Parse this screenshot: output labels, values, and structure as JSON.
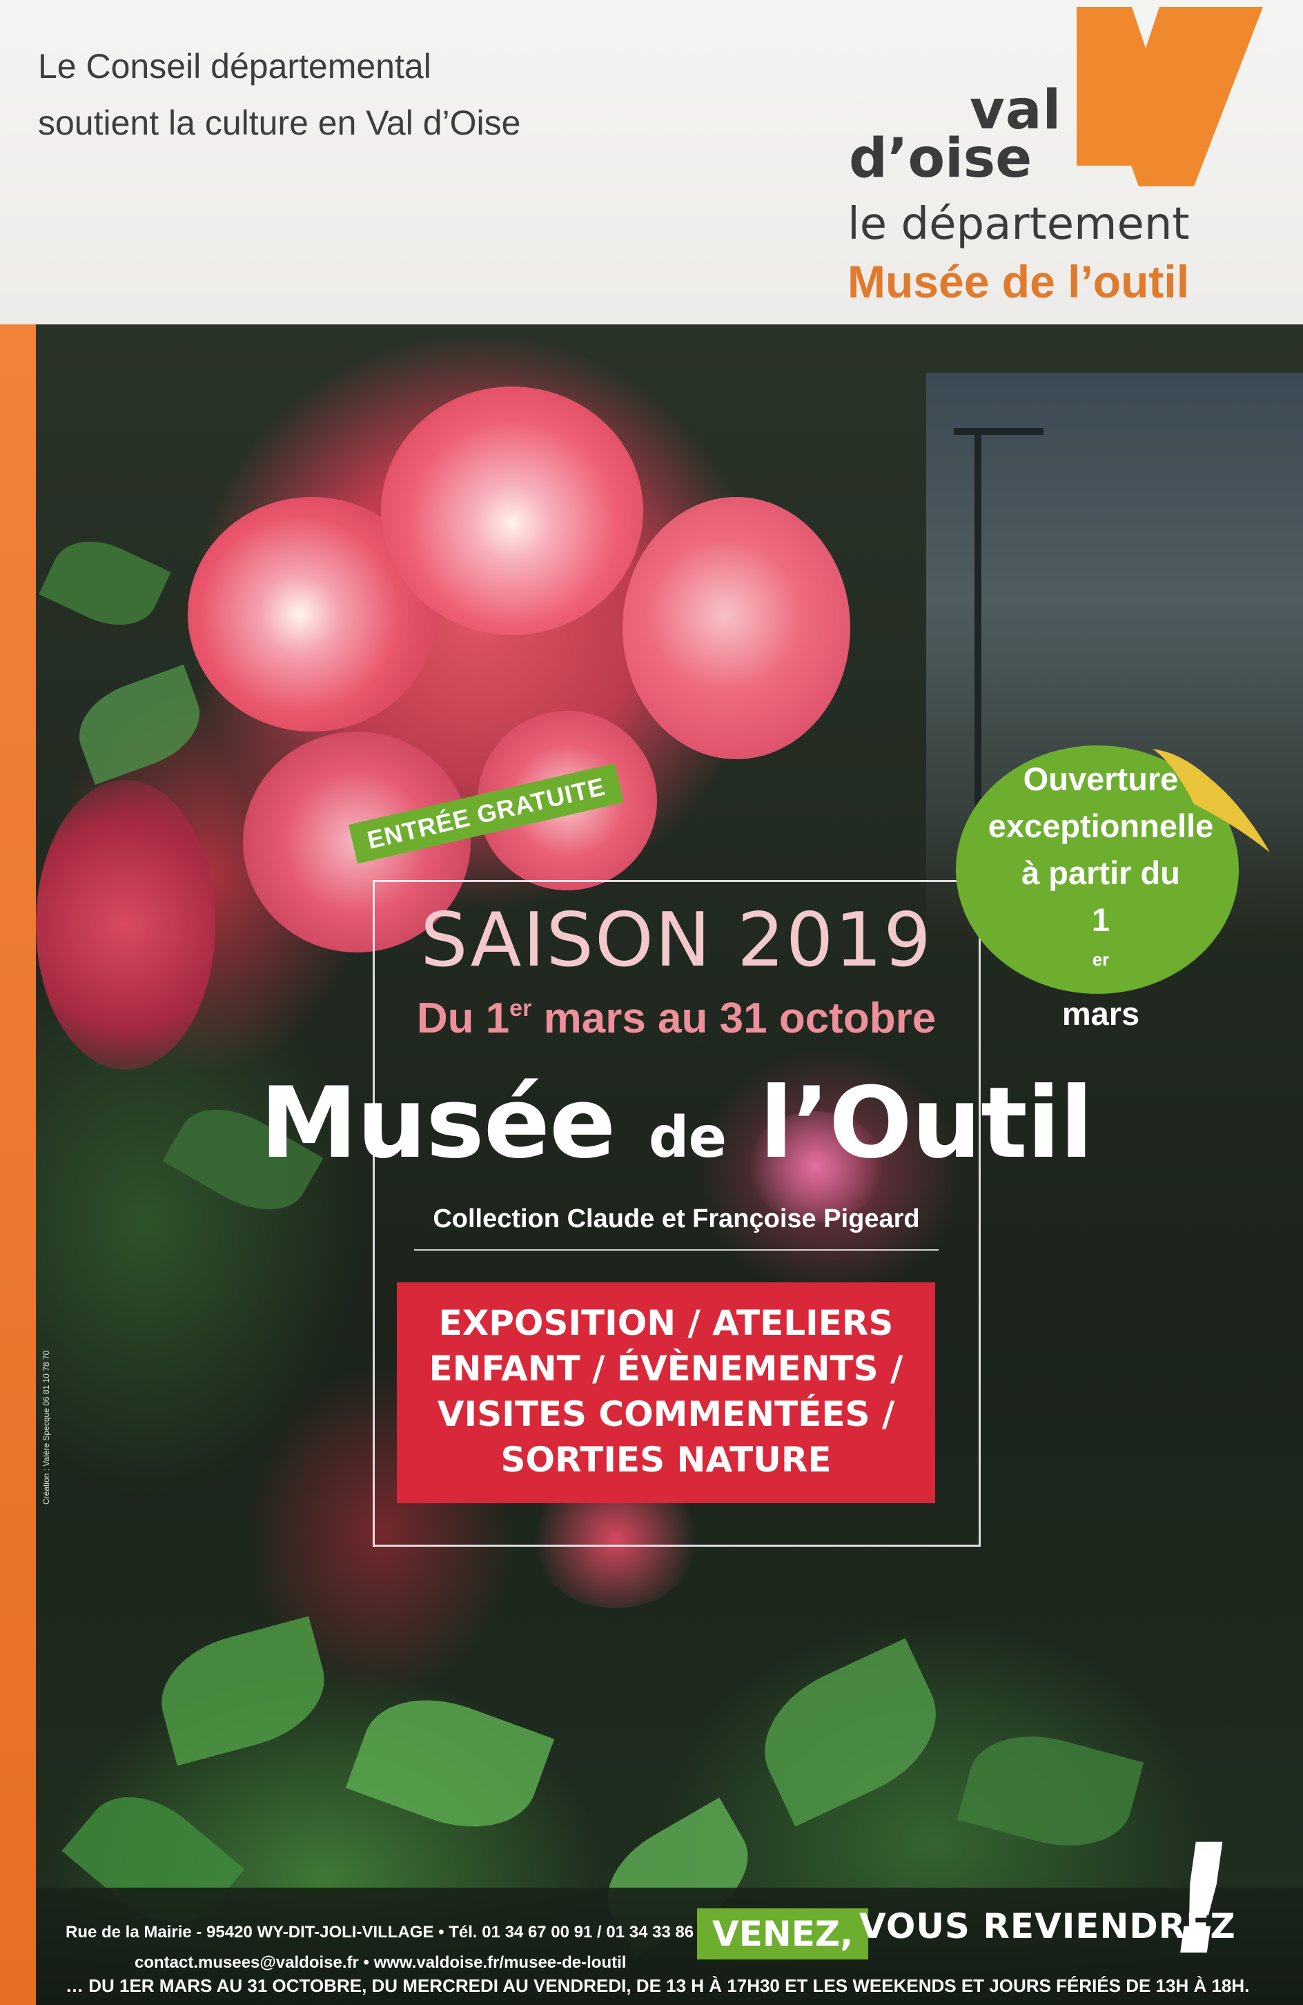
{
  "header": {
    "council_line1": "Le Conseil départemental",
    "council_line2": "soutient la culture en Val d’Oise",
    "logo_val": "val",
    "logo_doise": "d’oise",
    "logo_departement": "le département",
    "logo_musee": "Musée de l’outil"
  },
  "poster": {
    "entree": "ENTRÉE GRATUITE",
    "saison": "SAISON 2019",
    "dates_prefix": "Du 1",
    "dates_sup": "er",
    "dates_suffix": " mars au 31 octobre",
    "title_musee": "Musée",
    "title_de": "de",
    "title_outil": "l’Outil",
    "collection": "Collection Claude et Françoise Pigeard",
    "activities": [
      "EXPOSITION / ATELIERS",
      "ENFANT / ÉVÈNEMENTS /",
      "VISITES COMMENTÉES /",
      "SORTIES NATURE"
    ],
    "sticker_lines": [
      "Ouverture",
      "exceptionnelle",
      "à partir du"
    ],
    "sticker_last_prefix": "1",
    "sticker_last_sup": "er",
    "sticker_last_suffix": " mars",
    "credit": "Création : Valère Specque 06 81 10 78 70"
  },
  "footer": {
    "address": "Rue de la Mairie - 95420 WY-DIT-JOLI-VILLAGE • Tél. 01 34 67 00 91 / 01 34 33 86 00",
    "contact": "contact.musees@valdoise.fr • www.valdoise.fr/musee-de-loutil",
    "hours": "… DU 1ER MARS AU 31 OCTOBRE, DU MERCREDI AU VENDREDI, DE 13 H À 17H30 ET LES WEEKENDS ET JOURS FÉRIÉS DE 13H À 18H.",
    "venez": "VENEZ,",
    "reviendrez": "VOUS REVIENDREZ",
    "exclam": "!"
  },
  "colors": {
    "orange": "#e07a2c",
    "green": "#6dae2f",
    "red": "#d9283a",
    "pink": "#ee8f9c"
  }
}
